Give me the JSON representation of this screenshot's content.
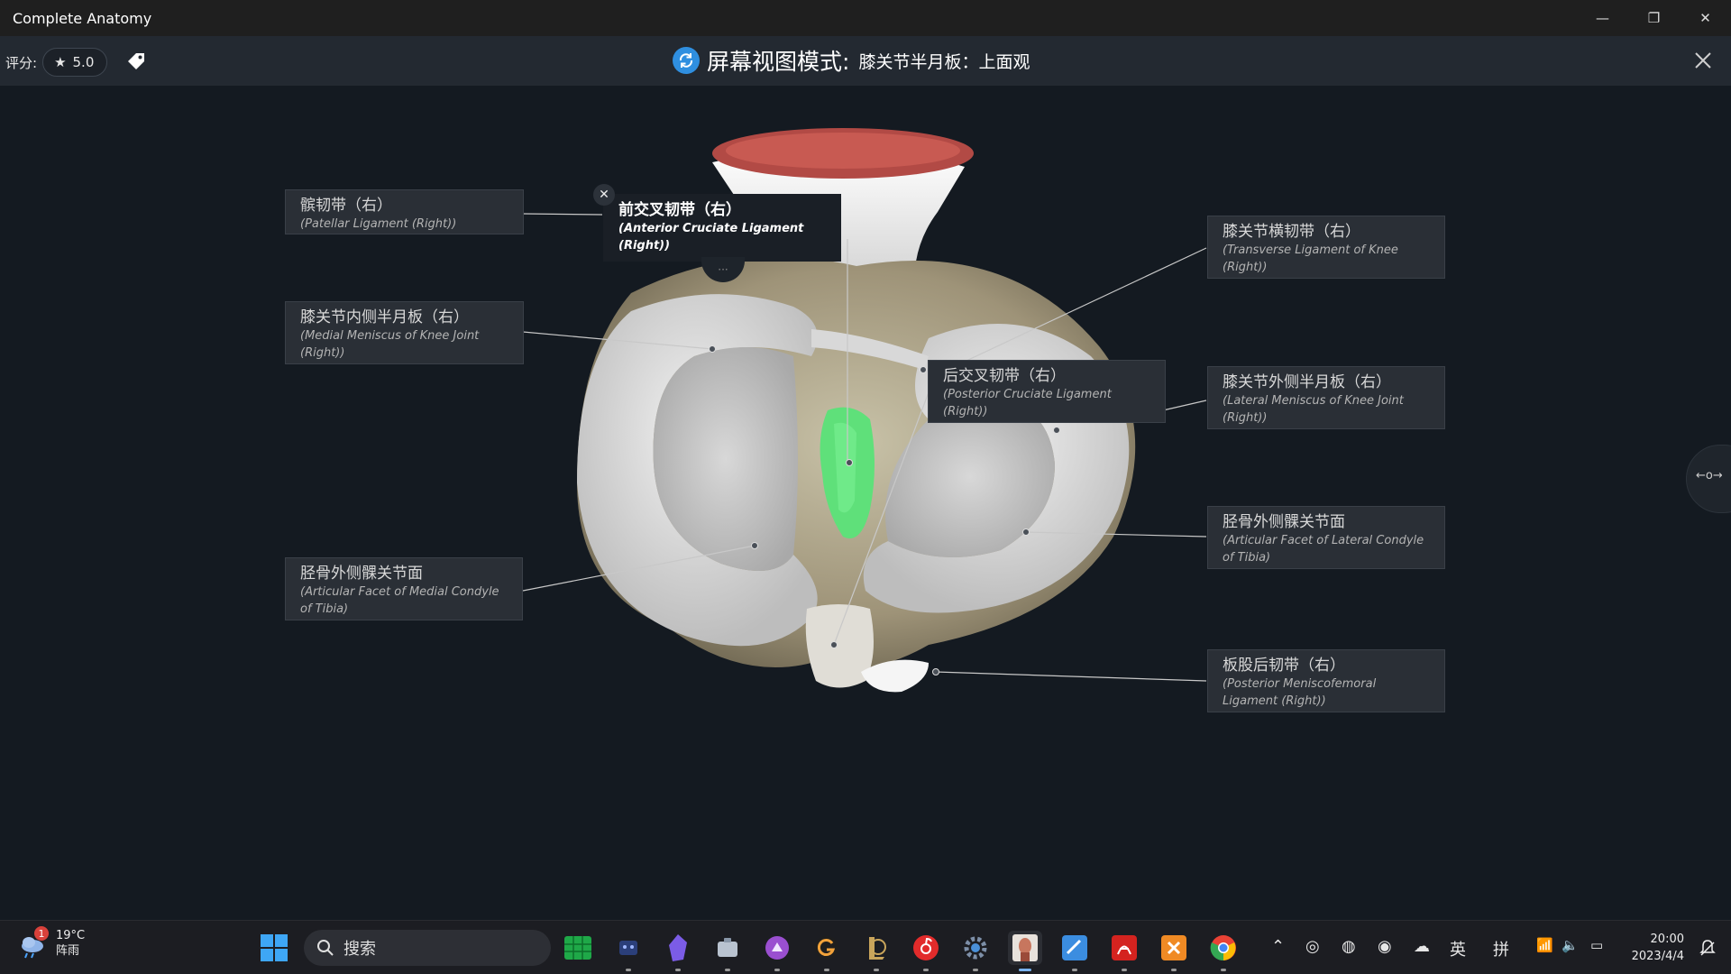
{
  "window": {
    "title": "Complete Anatomy",
    "minimize_icon": "—",
    "restore_icon": "❐",
    "close_icon": "✕"
  },
  "header": {
    "rating_label": "评分:",
    "rating_value": "5.0",
    "mode_label": "屏幕视图模式:",
    "mode_value": "膝关节半月板：上面观"
  },
  "labels": {
    "patellar": {
      "zh": "髌韧带（右）",
      "en": "(Patellar Ligament (Right))"
    },
    "acl": {
      "zh": "前交叉韧带（右）",
      "en": "(Anterior Cruciate Ligament (Right))",
      "close": "✕",
      "more": "···"
    },
    "medial_meniscus": {
      "zh": "膝关节内侧半月板（右）",
      "en": "(Medial Meniscus of Knee Joint (Right))"
    },
    "medial_facet": {
      "zh": "胫骨外侧髁关节面",
      "en": "(Articular Facet of Medial Condyle of Tibia)"
    },
    "transverse": {
      "zh": "膝关节横韧带（右）",
      "en": "(Transverse Ligament of Knee (Right))"
    },
    "pcl": {
      "zh": "后交叉韧带（右）",
      "en": "(Posterior Cruciate Ligament (Right))"
    },
    "lateral_meniscus": {
      "zh": "膝关节外侧半月板（右）",
      "en": "(Lateral Meniscus of Knee Joint (Right))"
    },
    "lateral_facet": {
      "zh": "胫骨外侧髁关节面",
      "en": "(Articular Facet of Lateral Condyle of Tibia)"
    },
    "meniscofemoral": {
      "zh": "板股后韧带（右）",
      "en": "(Posterior Meniscofemoral Ligament (Right))"
    }
  },
  "side_handle": "←o→",
  "taskbar": {
    "weather_temp": "19°C",
    "weather_desc": "阵雨",
    "weather_badge": "1",
    "search_placeholder": "搜索",
    "tray_ime_1": "英",
    "tray_ime_2": "拼",
    "time": "20:00",
    "date": "2023/4/4"
  },
  "colors": {
    "accent": "#2f8fe0",
    "acl_highlight": "#5fe07a"
  }
}
